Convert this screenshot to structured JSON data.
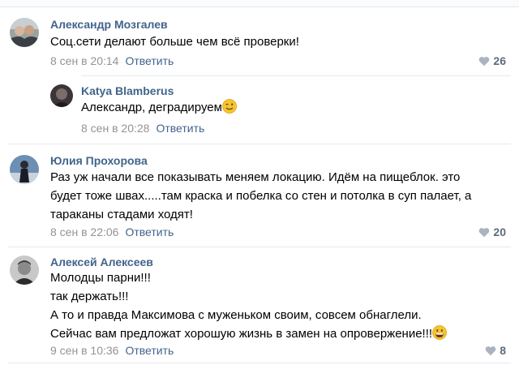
{
  "comments": [
    {
      "author": "Александр Мозгалев",
      "lines": [
        "Соц.сети делают больше чем всё проверки!"
      ],
      "date": "8 сен в 20:14",
      "reply": "Ответить",
      "likes": "26"
    },
    {
      "author": "Katya Blamberus",
      "lines": [
        "Александр, деградируем"
      ],
      "date": "8 сен в 20:28",
      "reply": "Ответить",
      "emoji": "wink-emoji"
    },
    {
      "author": "Юлия Прохорова",
      "lines": [
        "Раз уж начали все показывать меняем локацию. Идём на пищеблок. это",
        "будет тоже швах.....там краска и побелка со стен и потолка в суп палает, а",
        "тараканы стадами ходят!"
      ],
      "date": "8 сен в 22:06",
      "reply": "Ответить",
      "likes": "20"
    },
    {
      "author": "Алексей Алексеев",
      "lines": [
        "Молодцы парни!!!",
        "так держать!!!",
        "А то и правда Максимова с муженьком своим, совсем обнаглели.",
        "Сейчас вам предложат хорошую жизнь в замен на опровержение!!!"
      ],
      "date": "9 сен в 10:36",
      "reply": "Ответить",
      "likes": "8",
      "emoji": "grin-emoji"
    }
  ],
  "colors": {
    "author": "#42648b",
    "date": "#939393",
    "likes": "#5d6b7d",
    "divider": "#e7e8ec"
  }
}
